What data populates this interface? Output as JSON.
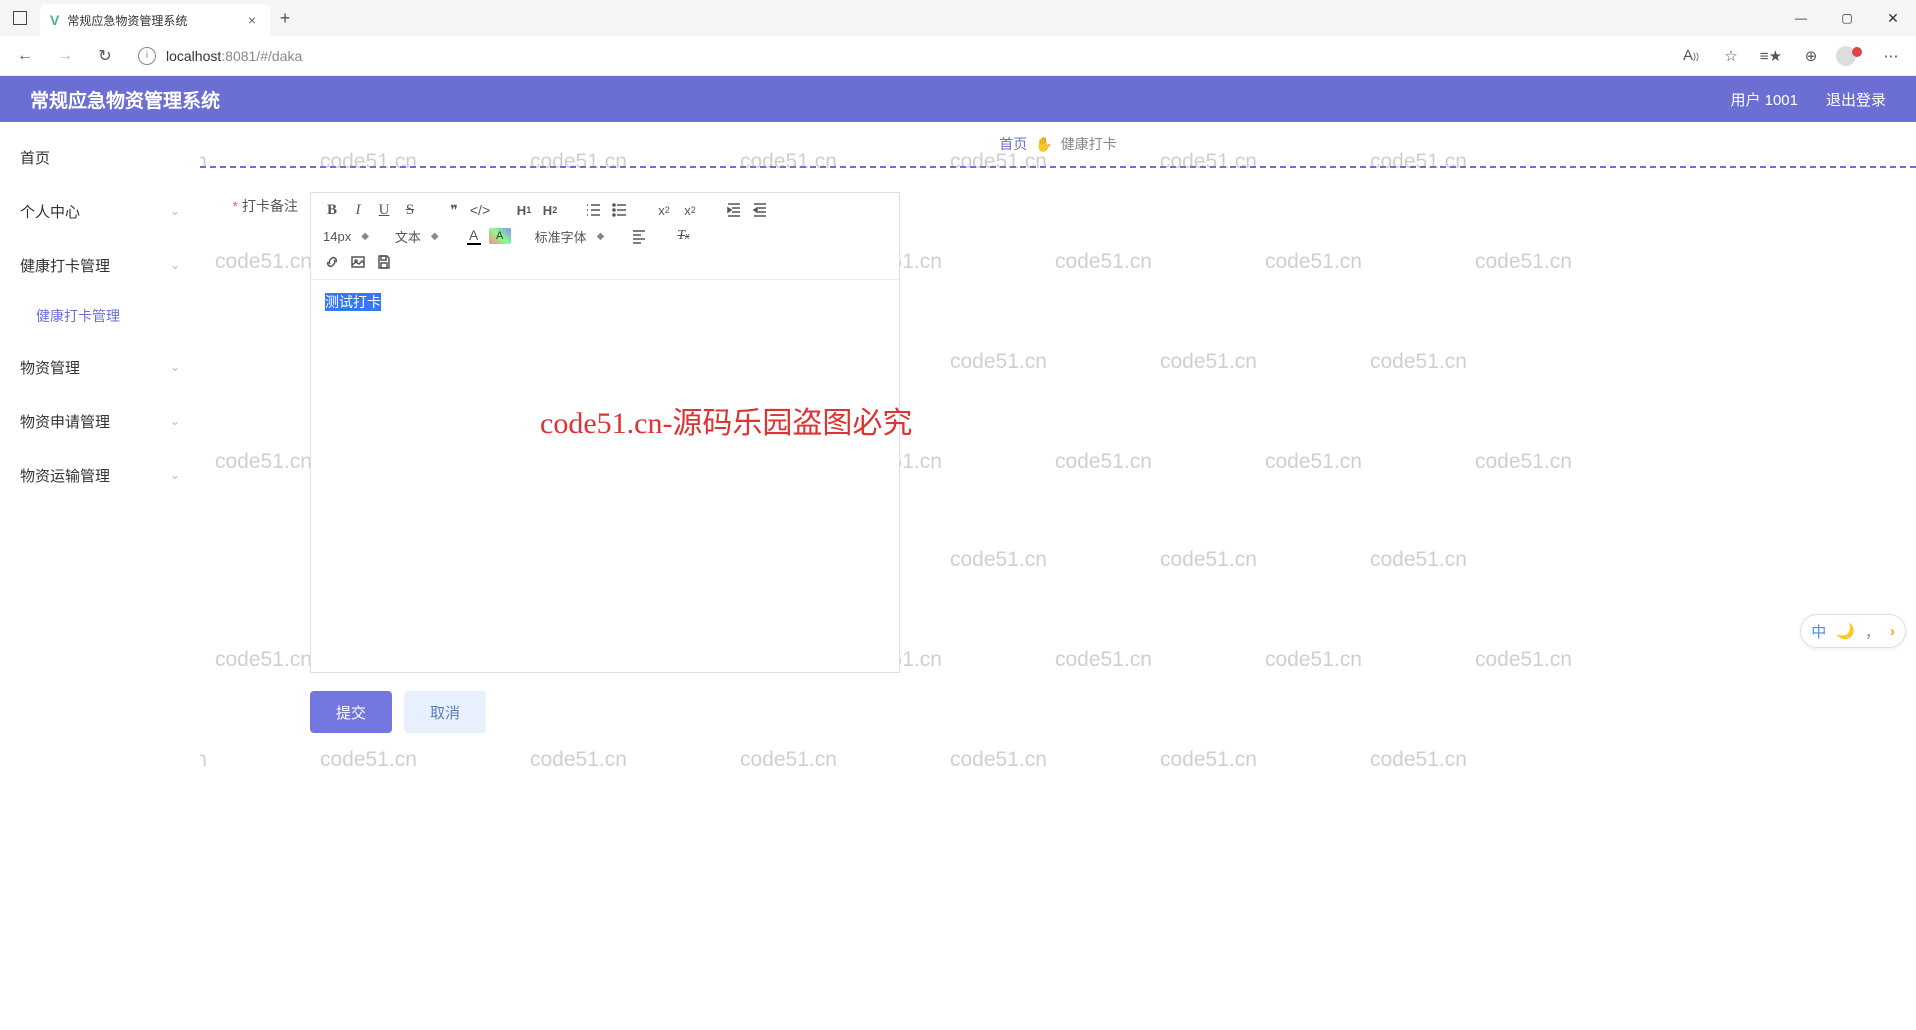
{
  "browser": {
    "tab_title": "常规应急物资管理系统",
    "url_host": "localhost",
    "url_path": ":8081/#/daka"
  },
  "header": {
    "app_title": "常规应急物资管理系统",
    "user_label": "用户 1001",
    "logout": "退出登录"
  },
  "sidebar": {
    "home": "首页",
    "personal": "个人中心",
    "health_mgmt": "健康打卡管理",
    "health_sub": "健康打卡管理",
    "material": "物资管理",
    "apply": "物资申请管理",
    "transport": "物资运输管理"
  },
  "breadcrumb": {
    "home": "首页",
    "emoji": "✋",
    "current": "健康打卡"
  },
  "form": {
    "label_note": "打卡备注",
    "required_mark": "*",
    "editor_text": "测试打卡",
    "submit": "提交",
    "cancel": "取消"
  },
  "toolbar": {
    "font_size": "14px",
    "paragraph": "文本",
    "font_family": "标准字体",
    "h1": "H",
    "h1s": "1",
    "h2": "H",
    "h2s": "2",
    "sub_x": "x",
    "sub_2": "2",
    "sup_x": "x",
    "sup_2": "2",
    "font_color_letter": "A",
    "bg_color_letter": "A"
  },
  "watermark": {
    "text": "code51.cn",
    "center": "code51.cn-源码乐园盗图必究"
  },
  "ime": {
    "lang": "中",
    "moon": "🌙",
    "comma": "，",
    "arrow": "›"
  }
}
